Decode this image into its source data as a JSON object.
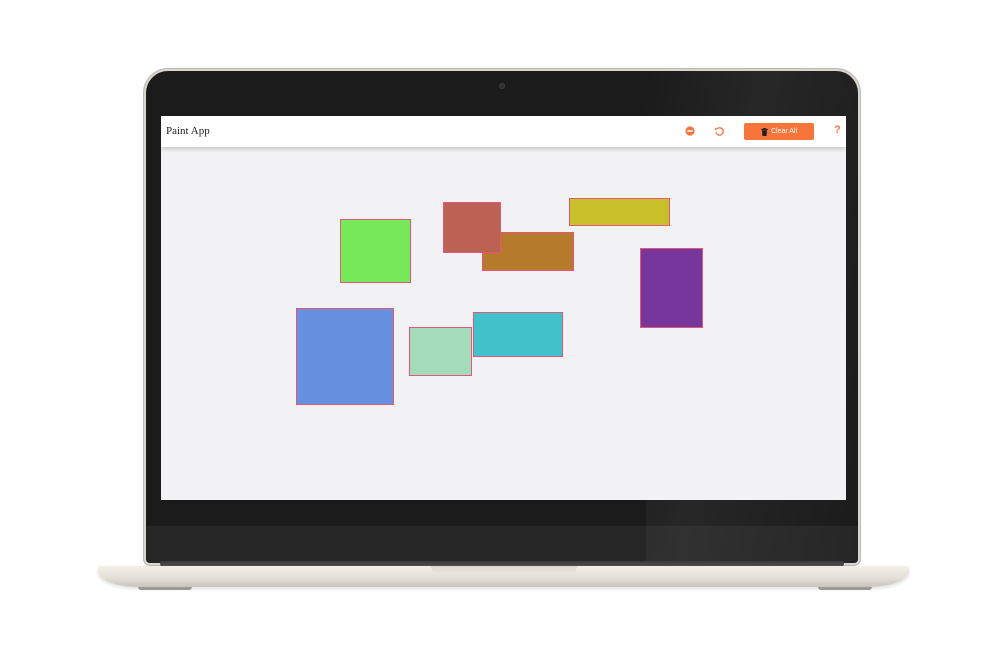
{
  "app": {
    "title": "Paint App"
  },
  "toolbar": {
    "eraser_icon": "minus-circle-icon",
    "undo_icon": "undo-icon",
    "clear_icon": "trash-icon",
    "clear_label": "Clear All",
    "help_label": "?",
    "accent_color": "#f7743a"
  },
  "canvas": {
    "background": "#f2f1f3",
    "shapes": [
      {
        "name": "green-rectangle",
        "color": "#77e857"
      },
      {
        "name": "red-rectangle",
        "color": "#bc6254"
      },
      {
        "name": "brown-rectangle",
        "color": "#b57a2c"
      },
      {
        "name": "yellow-rectangle",
        "color": "#c7c02b"
      },
      {
        "name": "purple-rectangle",
        "color": "#77369c"
      },
      {
        "name": "blue-rectangle",
        "color": "#6890e0"
      },
      {
        "name": "mint-rectangle",
        "color": "#a3dcb8"
      },
      {
        "name": "cyan-rectangle",
        "color": "#41c2ca"
      }
    ]
  }
}
